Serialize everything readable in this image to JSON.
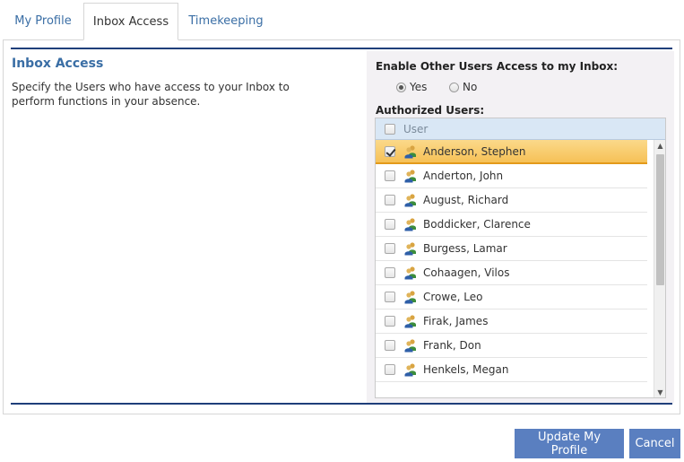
{
  "tabs": [
    {
      "label": "My Profile",
      "active": false
    },
    {
      "label": "Inbox Access",
      "active": true
    },
    {
      "label": "Timekeeping",
      "active": false
    }
  ],
  "section": {
    "title": "Inbox Access",
    "description": "Specify the Users who have access to your Inbox to perform functions in your absence."
  },
  "enable_access": {
    "label": "Enable Other Users Access to my Inbox:",
    "options": [
      {
        "label": "Yes",
        "selected": true
      },
      {
        "label": "No",
        "selected": false
      }
    ]
  },
  "authorized_users": {
    "label": "Authorized Users:",
    "column_header": "User",
    "rows": [
      {
        "name": "Anderson, Stephen",
        "checked": true,
        "selected": true
      },
      {
        "name": "Anderton, John",
        "checked": false,
        "selected": false
      },
      {
        "name": "August, Richard",
        "checked": false,
        "selected": false
      },
      {
        "name": "Boddicker, Clarence",
        "checked": false,
        "selected": false
      },
      {
        "name": "Burgess, Lamar",
        "checked": false,
        "selected": false
      },
      {
        "name": "Cohaagen, Vilos",
        "checked": false,
        "selected": false
      },
      {
        "name": "Crowe, Leo",
        "checked": false,
        "selected": false
      },
      {
        "name": "Firak, James",
        "checked": false,
        "selected": false
      },
      {
        "name": "Frank, Don",
        "checked": false,
        "selected": false
      },
      {
        "name": "Henkels, Megan",
        "checked": false,
        "selected": false
      }
    ]
  },
  "buttons": {
    "update": "Update My Profile",
    "cancel": "Cancel"
  },
  "colors": {
    "accent": "#3a6ea5",
    "rule": "#1f3f7a",
    "button": "#5a7fc0",
    "selected_row": "#f6c157"
  },
  "icons": {
    "row_icon": "users-group-icon",
    "scroll_up": "scroll-up-arrow-icon",
    "scroll_down": "scroll-down-arrow-icon"
  }
}
